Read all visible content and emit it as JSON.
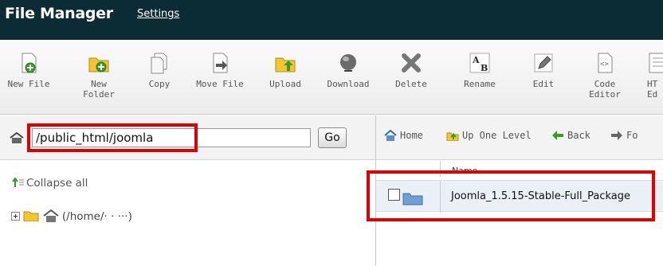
{
  "header": {
    "title": "File Manager",
    "settings_link": "Settings"
  },
  "toolbar": {
    "items": [
      {
        "label": "New File",
        "icon": "new-file-icon"
      },
      {
        "label": "New\nFolder",
        "icon": "new-folder-icon"
      },
      {
        "label": "Copy",
        "icon": "copy-icon"
      },
      {
        "label": "Move File",
        "icon": "move-file-icon"
      },
      {
        "label": "Upload",
        "icon": "upload-icon"
      },
      {
        "label": "Download",
        "icon": "download-icon"
      },
      {
        "label": "Delete",
        "icon": "delete-icon"
      },
      {
        "label": "Rename",
        "icon": "rename-icon"
      },
      {
        "label": "Edit",
        "icon": "edit-icon"
      },
      {
        "label": "Code\nEditor",
        "icon": "code-editor-icon"
      },
      {
        "label": "HT\nEd",
        "icon": "html-editor-icon"
      }
    ]
  },
  "path": {
    "value": "/public_html/joomla",
    "go_label": "Go"
  },
  "nav": {
    "home": "Home",
    "up_one_level": "Up One Level",
    "back": "Back",
    "forward": "Fo"
  },
  "tree": {
    "collapse_all": "Collapse all",
    "root_label": "(/home/· · ···)"
  },
  "file_list": {
    "column_name": "Name",
    "rows": [
      {
        "name": "Joomla_1.5.15-Stable-Full_Package"
      }
    ]
  },
  "colors": {
    "header_bg": "#0b2c35",
    "highlight": "#e00000",
    "row_bg": "#eaf0f6"
  }
}
